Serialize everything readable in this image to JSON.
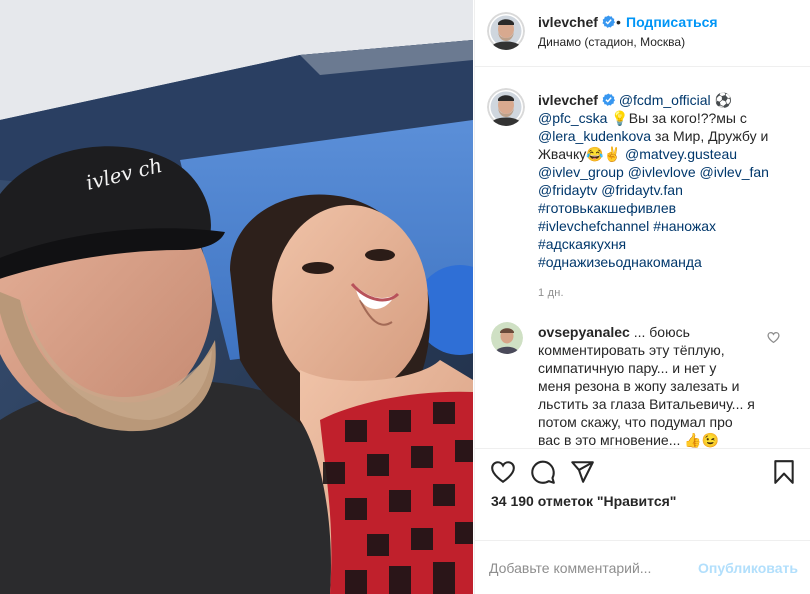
{
  "post": {
    "username": "ivlevchef",
    "follow_label": "Подписаться",
    "dot": "•",
    "location": "Динамо (стадион, Москва)",
    "photo_cap_text": "ivlev ch"
  },
  "caption": {
    "lines": [
      {
        "parts": [
          {
            "t": "ivlevchef",
            "s": "user"
          },
          {
            "t": " ",
            "s": "text"
          },
          {
            "t": "@fcdm_official",
            "s": "tag"
          },
          {
            "t": " ⚽",
            "s": "text"
          }
        ]
      },
      {
        "parts": [
          {
            "t": "@pfc_cska",
            "s": "tag"
          },
          {
            "t": " 💡Вы за кого!??мы с",
            "s": "text"
          }
        ]
      },
      {
        "parts": [
          {
            "t": "@lera_kudenkova",
            "s": "tag"
          },
          {
            "t": " за Мир, Дружбу и",
            "s": "text"
          }
        ]
      },
      {
        "parts": [
          {
            "t": "Жвачку😂✌ ",
            "s": "text"
          },
          {
            "t": "@matvey.gusteau",
            "s": "tag"
          }
        ]
      },
      {
        "parts": [
          {
            "t": "@ivlev_group",
            "s": "tag"
          },
          {
            "t": " ",
            "s": "text"
          },
          {
            "t": "@ivlevlove",
            "s": "tag"
          },
          {
            "t": " ",
            "s": "text"
          },
          {
            "t": "@ivlev_fan",
            "s": "tag"
          }
        ]
      },
      {
        "parts": [
          {
            "t": "@fridaytv",
            "s": "tag"
          },
          {
            "t": " ",
            "s": "text"
          },
          {
            "t": "@fridaytv.fan",
            "s": "tag"
          }
        ]
      },
      {
        "parts": [
          {
            "t": "#готовькакшефивлев",
            "s": "tag"
          }
        ]
      },
      {
        "parts": [
          {
            "t": "#ivlevchefchannel",
            "s": "tag"
          },
          {
            "t": " ",
            "s": "text"
          },
          {
            "t": "#наножах",
            "s": "tag"
          }
        ]
      },
      {
        "parts": [
          {
            "t": "#адскаякухня",
            "s": "tag"
          }
        ]
      },
      {
        "parts": [
          {
            "t": "#однажизеьоднакоманда",
            "s": "tag"
          }
        ]
      }
    ],
    "time": "1 дн."
  },
  "comment": {
    "username": "ovsepyanalec",
    "lines": [
      " ... боюсь",
      "комментировать эту тёплую,",
      "симпатичную пару... и нет у",
      "меня резона в жопу залезать и",
      "льстить за глаза Витальевичу... я",
      "потом скажу, что подумал про",
      "вас в это мгновение... 👍😉"
    ]
  },
  "actions": {
    "likes": "34 190 отметок \"Нравится\""
  },
  "add_comment": {
    "placeholder": "Добавьте комментарий...",
    "publish_label": "Опубликовать"
  },
  "colors": {
    "accent": "#0095f6",
    "tag": "#00376b",
    "muted": "#8e8e8e",
    "publish_disabled": "#b2dffc",
    "verified": "#3897f0"
  },
  "icons": [
    "verified-badge-icon",
    "heart-icon",
    "comment-icon",
    "share-icon",
    "bookmark-icon"
  ]
}
